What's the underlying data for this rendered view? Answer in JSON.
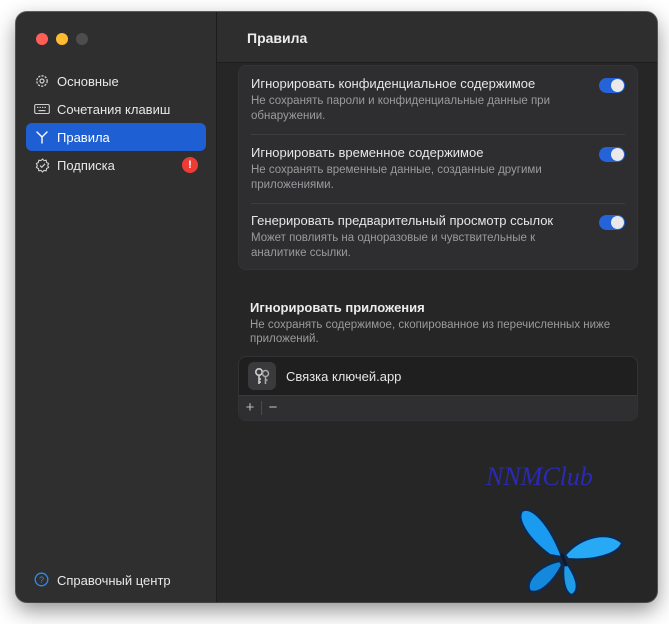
{
  "sidebar": {
    "items": [
      {
        "label": "Основные",
        "icon": "gear-icon",
        "active": false
      },
      {
        "label": "Сочетания клавиш",
        "icon": "keyboard-icon",
        "active": false
      },
      {
        "label": "Правила",
        "icon": "fork-icon",
        "active": true
      },
      {
        "label": "Подписка",
        "icon": "checkmark-seal-icon",
        "active": false,
        "badge": "!"
      }
    ],
    "help_label": "Справочный центр"
  },
  "main": {
    "title": "Правила",
    "rules": [
      {
        "title": "Игнорировать конфиденциальное содержимое",
        "description": "Не сохранять пароли и конфиденциальные данные при обнаружении.",
        "enabled": true
      },
      {
        "title": "Игнорировать временное содержимое",
        "description": "Не сохранять временные данные, созданные другими приложениями.",
        "enabled": true
      },
      {
        "title": "Генерировать предварительный просмотр ссылок",
        "description": "Может повлиять на одноразовые и чувствительные к аналитике ссылки.",
        "enabled": true
      }
    ],
    "ignore_apps": {
      "title": "Игнорировать приложения",
      "description": "Не сохранять содержимое, скопированное из перечисленных ниже приложений.",
      "apps": [
        {
          "name": "Связка ключей.app",
          "icon": "keychain-icon"
        }
      ],
      "add_label": "+",
      "remove_label": "−"
    }
  },
  "watermark": "NNMClub",
  "colors": {
    "accent": "#1f5fd4",
    "toggle_on": "#2563d9",
    "badge": "#ee3b36",
    "watermark": "#2a2ab8"
  }
}
